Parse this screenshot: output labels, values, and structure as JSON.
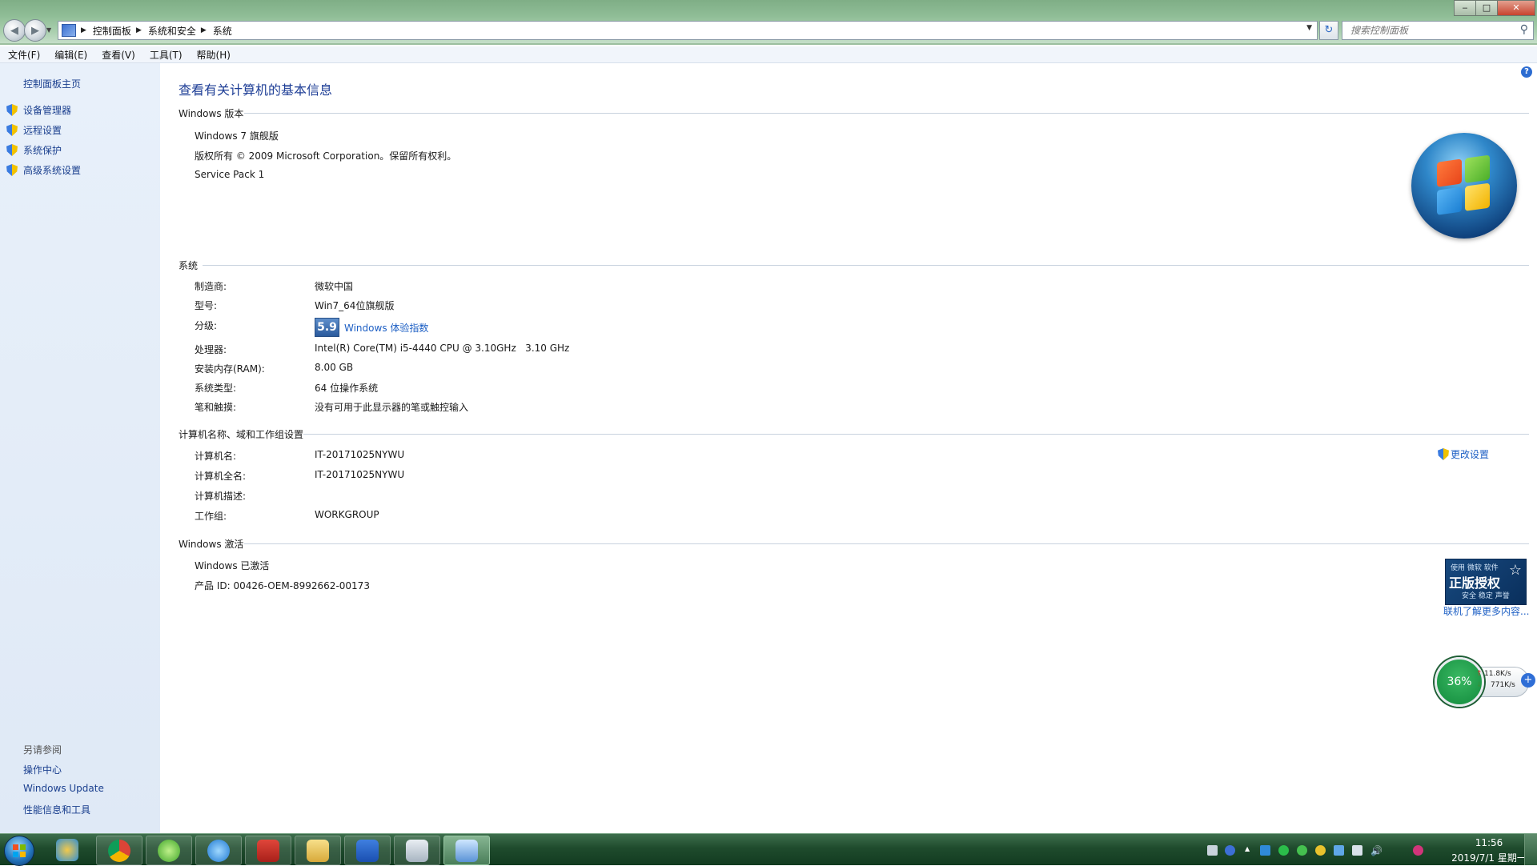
{
  "window": {
    "breadcrumb": [
      "控制面板",
      "系统和安全",
      "系统"
    ],
    "search_placeholder": "搜索控制面板",
    "controls": {
      "minimize": "‒",
      "maximize": "□",
      "close": "✕"
    }
  },
  "menubar": [
    "文件(F)",
    "编辑(E)",
    "查看(V)",
    "工具(T)",
    "帮助(H)"
  ],
  "sidebar": {
    "home": "控制面板主页",
    "links": [
      "设备管理器",
      "远程设置",
      "系统保护",
      "高级系统设置"
    ],
    "see_also_title": "另请参阅",
    "see_also": [
      "操作中心",
      "Windows Update",
      "性能信息和工具"
    ]
  },
  "main": {
    "title": "查看有关计算机的基本信息",
    "edition": {
      "header": "Windows 版本",
      "name": "Windows 7 旗舰版",
      "copyright": "版权所有 © 2009 Microsoft Corporation。保留所有权利。",
      "service_pack": "Service Pack 1"
    },
    "system": {
      "header": "系统",
      "manufacturer_label": "制造商:",
      "manufacturer": "微软中国",
      "model_label": "型号:",
      "model": "Win7_64位旗舰版",
      "rating_label": "分级:",
      "rating_score": "5.9",
      "rating_link": "Windows 体验指数",
      "processor_label": "处理器:",
      "processor": "Intel(R) Core(TM) i5-4440 CPU @ 3.10GHz   3.10 GHz",
      "ram_label": "安装内存(RAM):",
      "ram": "8.00 GB",
      "type_label": "系统类型:",
      "type": "64 位操作系统",
      "pen_label": "笔和触摸:",
      "pen": "没有可用于此显示器的笔或触控输入"
    },
    "computer": {
      "header": "计算机名称、域和工作组设置",
      "name_label": "计算机名:",
      "name": "IT-20171025NYWU",
      "fullname_label": "计算机全名:",
      "fullname": "IT-20171025NYWU",
      "desc_label": "计算机描述:",
      "desc": "",
      "workgroup_label": "工作组:",
      "workgroup": "WORKGROUP",
      "change_link": "更改设置"
    },
    "activation": {
      "header": "Windows 激活",
      "status": "Windows 已激活",
      "product_id": "产品 ID: 00426-OEM-8992662-00173",
      "genuine_top": "使用 微软 软件",
      "genuine_main": "正版授权",
      "genuine_bottom": "安全 稳定 声誉",
      "more_link": "联机了解更多内容..."
    }
  },
  "net_widget": {
    "percent": "36%",
    "up": "11.8K/s",
    "down": "771K/s"
  },
  "taskbar": {
    "time": "11:56",
    "date": "2019/7/1 星期一"
  },
  "colors": {
    "link": "#1d5fc4",
    "title": "#1e3e96",
    "taskbar": "#1f4b2d"
  }
}
